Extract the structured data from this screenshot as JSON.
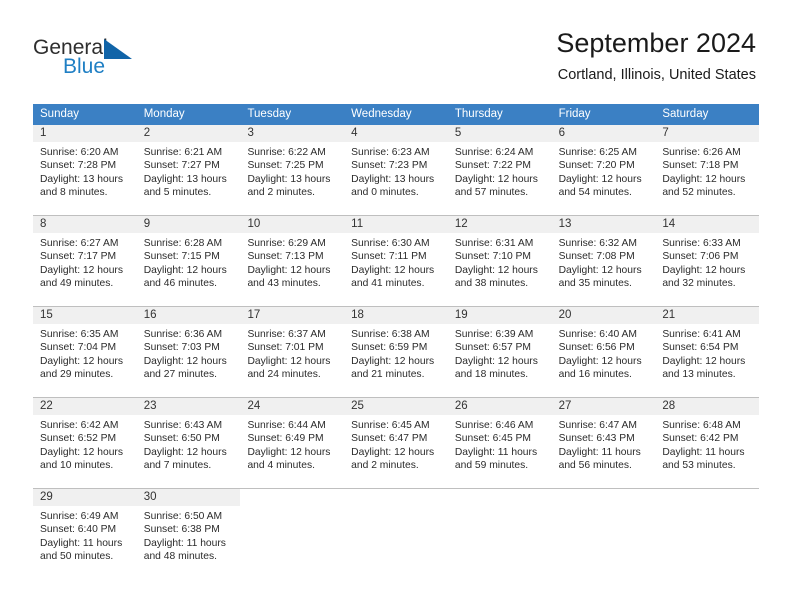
{
  "brand": {
    "name_part1": "General",
    "name_part2": "Blue"
  },
  "header": {
    "title": "September 2024",
    "subtitle": "Cortland, Illinois, United States"
  },
  "colors": {
    "header_blue": "#3b80c4",
    "logo_blue": "#1164a8",
    "daynum_band": "#f0f0f0",
    "grid_line": "#bfbfbf"
  },
  "weekdays": [
    "Sunday",
    "Monday",
    "Tuesday",
    "Wednesday",
    "Thursday",
    "Friday",
    "Saturday"
  ],
  "weeks": [
    [
      {
        "day": "1",
        "lines": [
          "Sunrise: 6:20 AM",
          "Sunset: 7:28 PM",
          "Daylight: 13 hours",
          "and 8 minutes."
        ]
      },
      {
        "day": "2",
        "lines": [
          "Sunrise: 6:21 AM",
          "Sunset: 7:27 PM",
          "Daylight: 13 hours",
          "and 5 minutes."
        ]
      },
      {
        "day": "3",
        "lines": [
          "Sunrise: 6:22 AM",
          "Sunset: 7:25 PM",
          "Daylight: 13 hours",
          "and 2 minutes."
        ]
      },
      {
        "day": "4",
        "lines": [
          "Sunrise: 6:23 AM",
          "Sunset: 7:23 PM",
          "Daylight: 13 hours",
          "and 0 minutes."
        ]
      },
      {
        "day": "5",
        "lines": [
          "Sunrise: 6:24 AM",
          "Sunset: 7:22 PM",
          "Daylight: 12 hours",
          "and 57 minutes."
        ]
      },
      {
        "day": "6",
        "lines": [
          "Sunrise: 6:25 AM",
          "Sunset: 7:20 PM",
          "Daylight: 12 hours",
          "and 54 minutes."
        ]
      },
      {
        "day": "7",
        "lines": [
          "Sunrise: 6:26 AM",
          "Sunset: 7:18 PM",
          "Daylight: 12 hours",
          "and 52 minutes."
        ]
      }
    ],
    [
      {
        "day": "8",
        "lines": [
          "Sunrise: 6:27 AM",
          "Sunset: 7:17 PM",
          "Daylight: 12 hours",
          "and 49 minutes."
        ]
      },
      {
        "day": "9",
        "lines": [
          "Sunrise: 6:28 AM",
          "Sunset: 7:15 PM",
          "Daylight: 12 hours",
          "and 46 minutes."
        ]
      },
      {
        "day": "10",
        "lines": [
          "Sunrise: 6:29 AM",
          "Sunset: 7:13 PM",
          "Daylight: 12 hours",
          "and 43 minutes."
        ]
      },
      {
        "day": "11",
        "lines": [
          "Sunrise: 6:30 AM",
          "Sunset: 7:11 PM",
          "Daylight: 12 hours",
          "and 41 minutes."
        ]
      },
      {
        "day": "12",
        "lines": [
          "Sunrise: 6:31 AM",
          "Sunset: 7:10 PM",
          "Daylight: 12 hours",
          "and 38 minutes."
        ]
      },
      {
        "day": "13",
        "lines": [
          "Sunrise: 6:32 AM",
          "Sunset: 7:08 PM",
          "Daylight: 12 hours",
          "and 35 minutes."
        ]
      },
      {
        "day": "14",
        "lines": [
          "Sunrise: 6:33 AM",
          "Sunset: 7:06 PM",
          "Daylight: 12 hours",
          "and 32 minutes."
        ]
      }
    ],
    [
      {
        "day": "15",
        "lines": [
          "Sunrise: 6:35 AM",
          "Sunset: 7:04 PM",
          "Daylight: 12 hours",
          "and 29 minutes."
        ]
      },
      {
        "day": "16",
        "lines": [
          "Sunrise: 6:36 AM",
          "Sunset: 7:03 PM",
          "Daylight: 12 hours",
          "and 27 minutes."
        ]
      },
      {
        "day": "17",
        "lines": [
          "Sunrise: 6:37 AM",
          "Sunset: 7:01 PM",
          "Daylight: 12 hours",
          "and 24 minutes."
        ]
      },
      {
        "day": "18",
        "lines": [
          "Sunrise: 6:38 AM",
          "Sunset: 6:59 PM",
          "Daylight: 12 hours",
          "and 21 minutes."
        ]
      },
      {
        "day": "19",
        "lines": [
          "Sunrise: 6:39 AM",
          "Sunset: 6:57 PM",
          "Daylight: 12 hours",
          "and 18 minutes."
        ]
      },
      {
        "day": "20",
        "lines": [
          "Sunrise: 6:40 AM",
          "Sunset: 6:56 PM",
          "Daylight: 12 hours",
          "and 16 minutes."
        ]
      },
      {
        "day": "21",
        "lines": [
          "Sunrise: 6:41 AM",
          "Sunset: 6:54 PM",
          "Daylight: 12 hours",
          "and 13 minutes."
        ]
      }
    ],
    [
      {
        "day": "22",
        "lines": [
          "Sunrise: 6:42 AM",
          "Sunset: 6:52 PM",
          "Daylight: 12 hours",
          "and 10 minutes."
        ]
      },
      {
        "day": "23",
        "lines": [
          "Sunrise: 6:43 AM",
          "Sunset: 6:50 PM",
          "Daylight: 12 hours",
          "and 7 minutes."
        ]
      },
      {
        "day": "24",
        "lines": [
          "Sunrise: 6:44 AM",
          "Sunset: 6:49 PM",
          "Daylight: 12 hours",
          "and 4 minutes."
        ]
      },
      {
        "day": "25",
        "lines": [
          "Sunrise: 6:45 AM",
          "Sunset: 6:47 PM",
          "Daylight: 12 hours",
          "and 2 minutes."
        ]
      },
      {
        "day": "26",
        "lines": [
          "Sunrise: 6:46 AM",
          "Sunset: 6:45 PM",
          "Daylight: 11 hours",
          "and 59 minutes."
        ]
      },
      {
        "day": "27",
        "lines": [
          "Sunrise: 6:47 AM",
          "Sunset: 6:43 PM",
          "Daylight: 11 hours",
          "and 56 minutes."
        ]
      },
      {
        "day": "28",
        "lines": [
          "Sunrise: 6:48 AM",
          "Sunset: 6:42 PM",
          "Daylight: 11 hours",
          "and 53 minutes."
        ]
      }
    ],
    [
      {
        "day": "29",
        "lines": [
          "Sunrise: 6:49 AM",
          "Sunset: 6:40 PM",
          "Daylight: 11 hours",
          "and 50 minutes."
        ]
      },
      {
        "day": "30",
        "lines": [
          "Sunrise: 6:50 AM",
          "Sunset: 6:38 PM",
          "Daylight: 11 hours",
          "and 48 minutes."
        ]
      },
      {
        "day": "",
        "lines": []
      },
      {
        "day": "",
        "lines": []
      },
      {
        "day": "",
        "lines": []
      },
      {
        "day": "",
        "lines": []
      },
      {
        "day": "",
        "lines": []
      }
    ]
  ]
}
